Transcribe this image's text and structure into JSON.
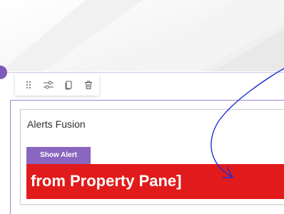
{
  "toolbar": {
    "items": [
      {
        "name": "drag-handle-icon",
        "tooltip": ""
      },
      {
        "name": "settings-sliders-icon",
        "tooltip": ""
      },
      {
        "name": "duplicate-icon",
        "tooltip": ""
      },
      {
        "name": "trash-icon",
        "tooltip": ""
      }
    ]
  },
  "webpart": {
    "title": "Alerts Fusion",
    "button_label": "Show Alert",
    "alert_text": "from Property Pane]"
  },
  "colors": {
    "accent": "#8b66c0",
    "frame": "#9c86c8",
    "alert": "#e11b1b",
    "annotation": "#1c2fd8"
  }
}
